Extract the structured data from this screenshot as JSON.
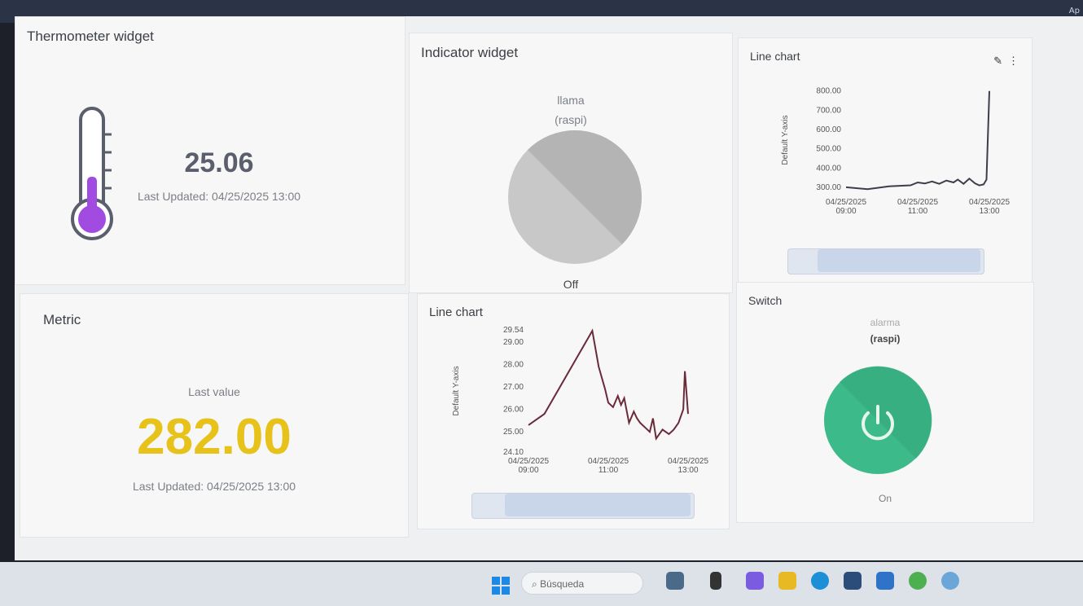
{
  "topbar": {
    "apps_label": "Ap"
  },
  "thermometer": {
    "title": "Thermometer widget",
    "value": "25.06",
    "updated": "Last Updated: 04/25/2025 13:00",
    "color": "#a24be0"
  },
  "indicator": {
    "title": "Indicator widget",
    "device": "llama",
    "source": "(raspi)",
    "state": "Off"
  },
  "line_chart_top": {
    "title": "Line chart",
    "chart_data": {
      "type": "line",
      "title": "Line chart",
      "ylabel": "Default Y-axis",
      "yticks": [
        "800.00",
        "700.00",
        "600.00",
        "500.00",
        "400.00",
        "300.00"
      ],
      "xticks": [
        {
          "date": "04/25/2025",
          "time": "09:00"
        },
        {
          "date": "04/25/2025",
          "time": "11:00"
        },
        {
          "date": "04/25/2025",
          "time": "13:00"
        }
      ],
      "ylim": [
        270,
        820
      ],
      "series": [
        {
          "x": [
            0,
            0.15,
            0.3,
            0.45,
            0.5,
            0.55,
            0.6,
            0.65,
            0.7,
            0.75,
            0.78,
            0.82,
            0.86,
            0.9,
            0.93,
            0.96,
            0.98,
            1.0
          ],
          "values": [
            300,
            290,
            305,
            310,
            325,
            320,
            330,
            318,
            335,
            325,
            340,
            318,
            345,
            320,
            310,
            315,
            340,
            800
          ]
        }
      ]
    }
  },
  "metric": {
    "title": "Metric",
    "caption": "Last value",
    "value": "282.00",
    "updated": "Last Updated: 04/25/2025 13:00",
    "color": "#e6c21a"
  },
  "line_chart_bottom": {
    "title": "Line chart",
    "chart_data": {
      "type": "line",
      "title": "Line chart",
      "ylabel": "Default Y-axis",
      "yticks": [
        "29.54",
        "29.00",
        "28.00",
        "27.00",
        "26.00",
        "25.00",
        "24.10"
      ],
      "xticks": [
        {
          "date": "04/25/2025",
          "time": "09:00"
        },
        {
          "date": "04/25/2025",
          "time": "11:00"
        },
        {
          "date": "04/25/2025",
          "time": "13:00"
        }
      ],
      "ylim": [
        24.1,
        29.54
      ],
      "series": [
        {
          "x": [
            0,
            0.1,
            0.4,
            0.44,
            0.48,
            0.5,
            0.53,
            0.56,
            0.58,
            0.6,
            0.63,
            0.66,
            0.68,
            0.7,
            0.73,
            0.76,
            0.78,
            0.8,
            0.84,
            0.88,
            0.91,
            0.94,
            0.97,
            0.98,
            1.0
          ],
          "values": [
            25.3,
            25.8,
            29.5,
            27.9,
            26.9,
            26.3,
            26.1,
            26.6,
            26.2,
            26.5,
            25.4,
            25.9,
            25.6,
            25.4,
            25.2,
            25.0,
            25.6,
            24.7,
            25.1,
            24.9,
            25.1,
            25.4,
            26.0,
            27.7,
            25.8
          ]
        }
      ]
    }
  },
  "switch_widget": {
    "title": "Switch",
    "device": "alarma",
    "source": "(raspi)",
    "state": "On",
    "color": "#3dba8a"
  },
  "taskbar": {
    "search_placeholder": "Búsqueda"
  }
}
